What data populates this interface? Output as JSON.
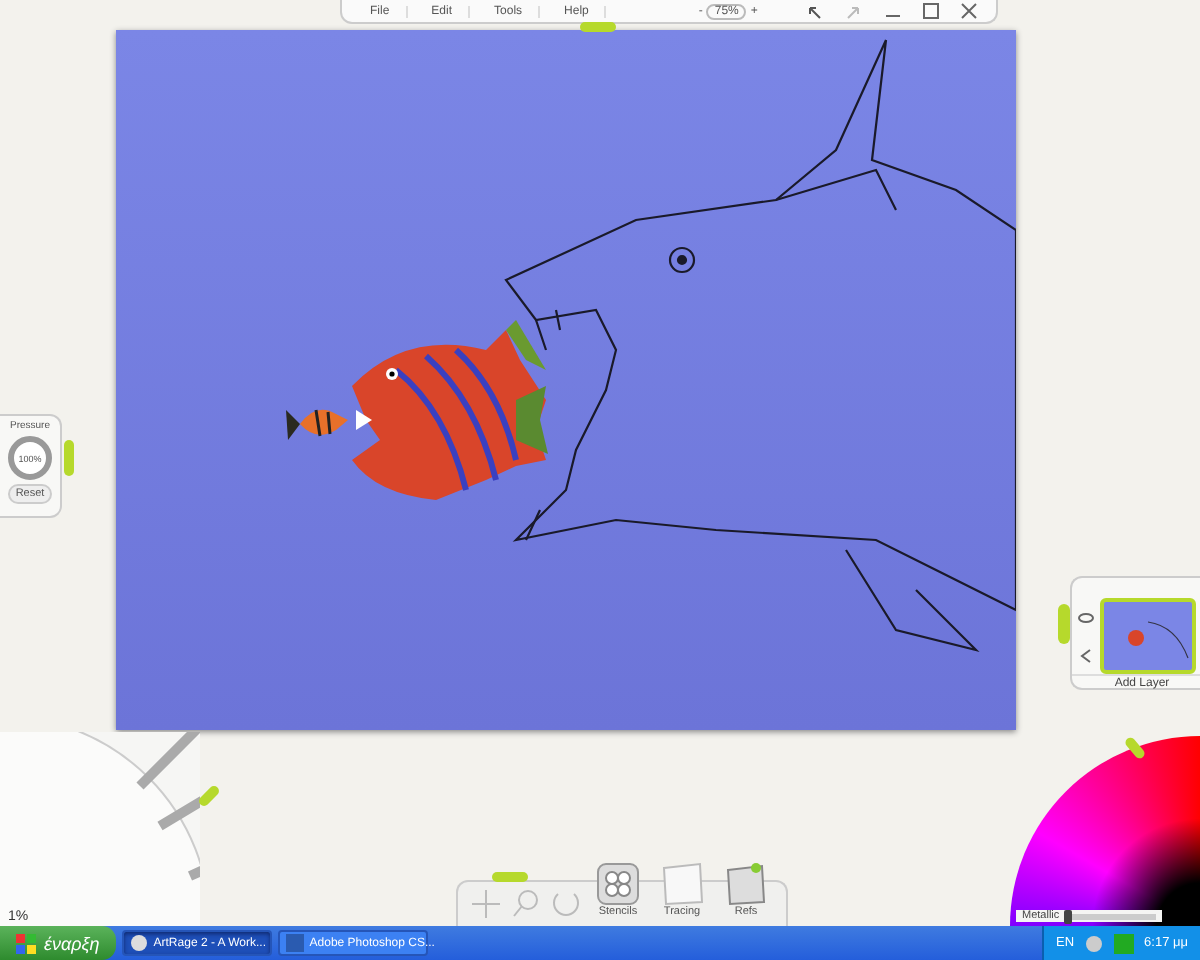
{
  "menu": [
    {
      "label": "File"
    },
    {
      "label": "Edit"
    },
    {
      "label": "Tools"
    },
    {
      "label": "Help"
    }
  ],
  "zoom": {
    "minus": "-",
    "value": "75%",
    "plus": "+"
  },
  "pressure": {
    "label": "Pressure",
    "value": "100%",
    "reset": "Reset"
  },
  "layers": {
    "add": "Add Layer"
  },
  "tool_size": "1%",
  "bottom_tools": [
    {
      "label": "Stencils",
      "kind": "stencil"
    },
    {
      "label": "Tracing",
      "kind": "tracing"
    },
    {
      "label": "Refs",
      "kind": "refs"
    }
  ],
  "color_picker": {
    "metallic_label": "Metallic",
    "metallic": {
      "level": 0
    }
  },
  "taskbar": {
    "start": "έναρξη",
    "tasks": [
      {
        "label": "ArtRage 2 - A Work...",
        "selected": true,
        "kind": "artrage"
      },
      {
        "label": "Adobe Photoshop CS...",
        "selected": false,
        "kind": "photoshop"
      }
    ],
    "lang": "EN",
    "clock": "6:17 μμ"
  }
}
